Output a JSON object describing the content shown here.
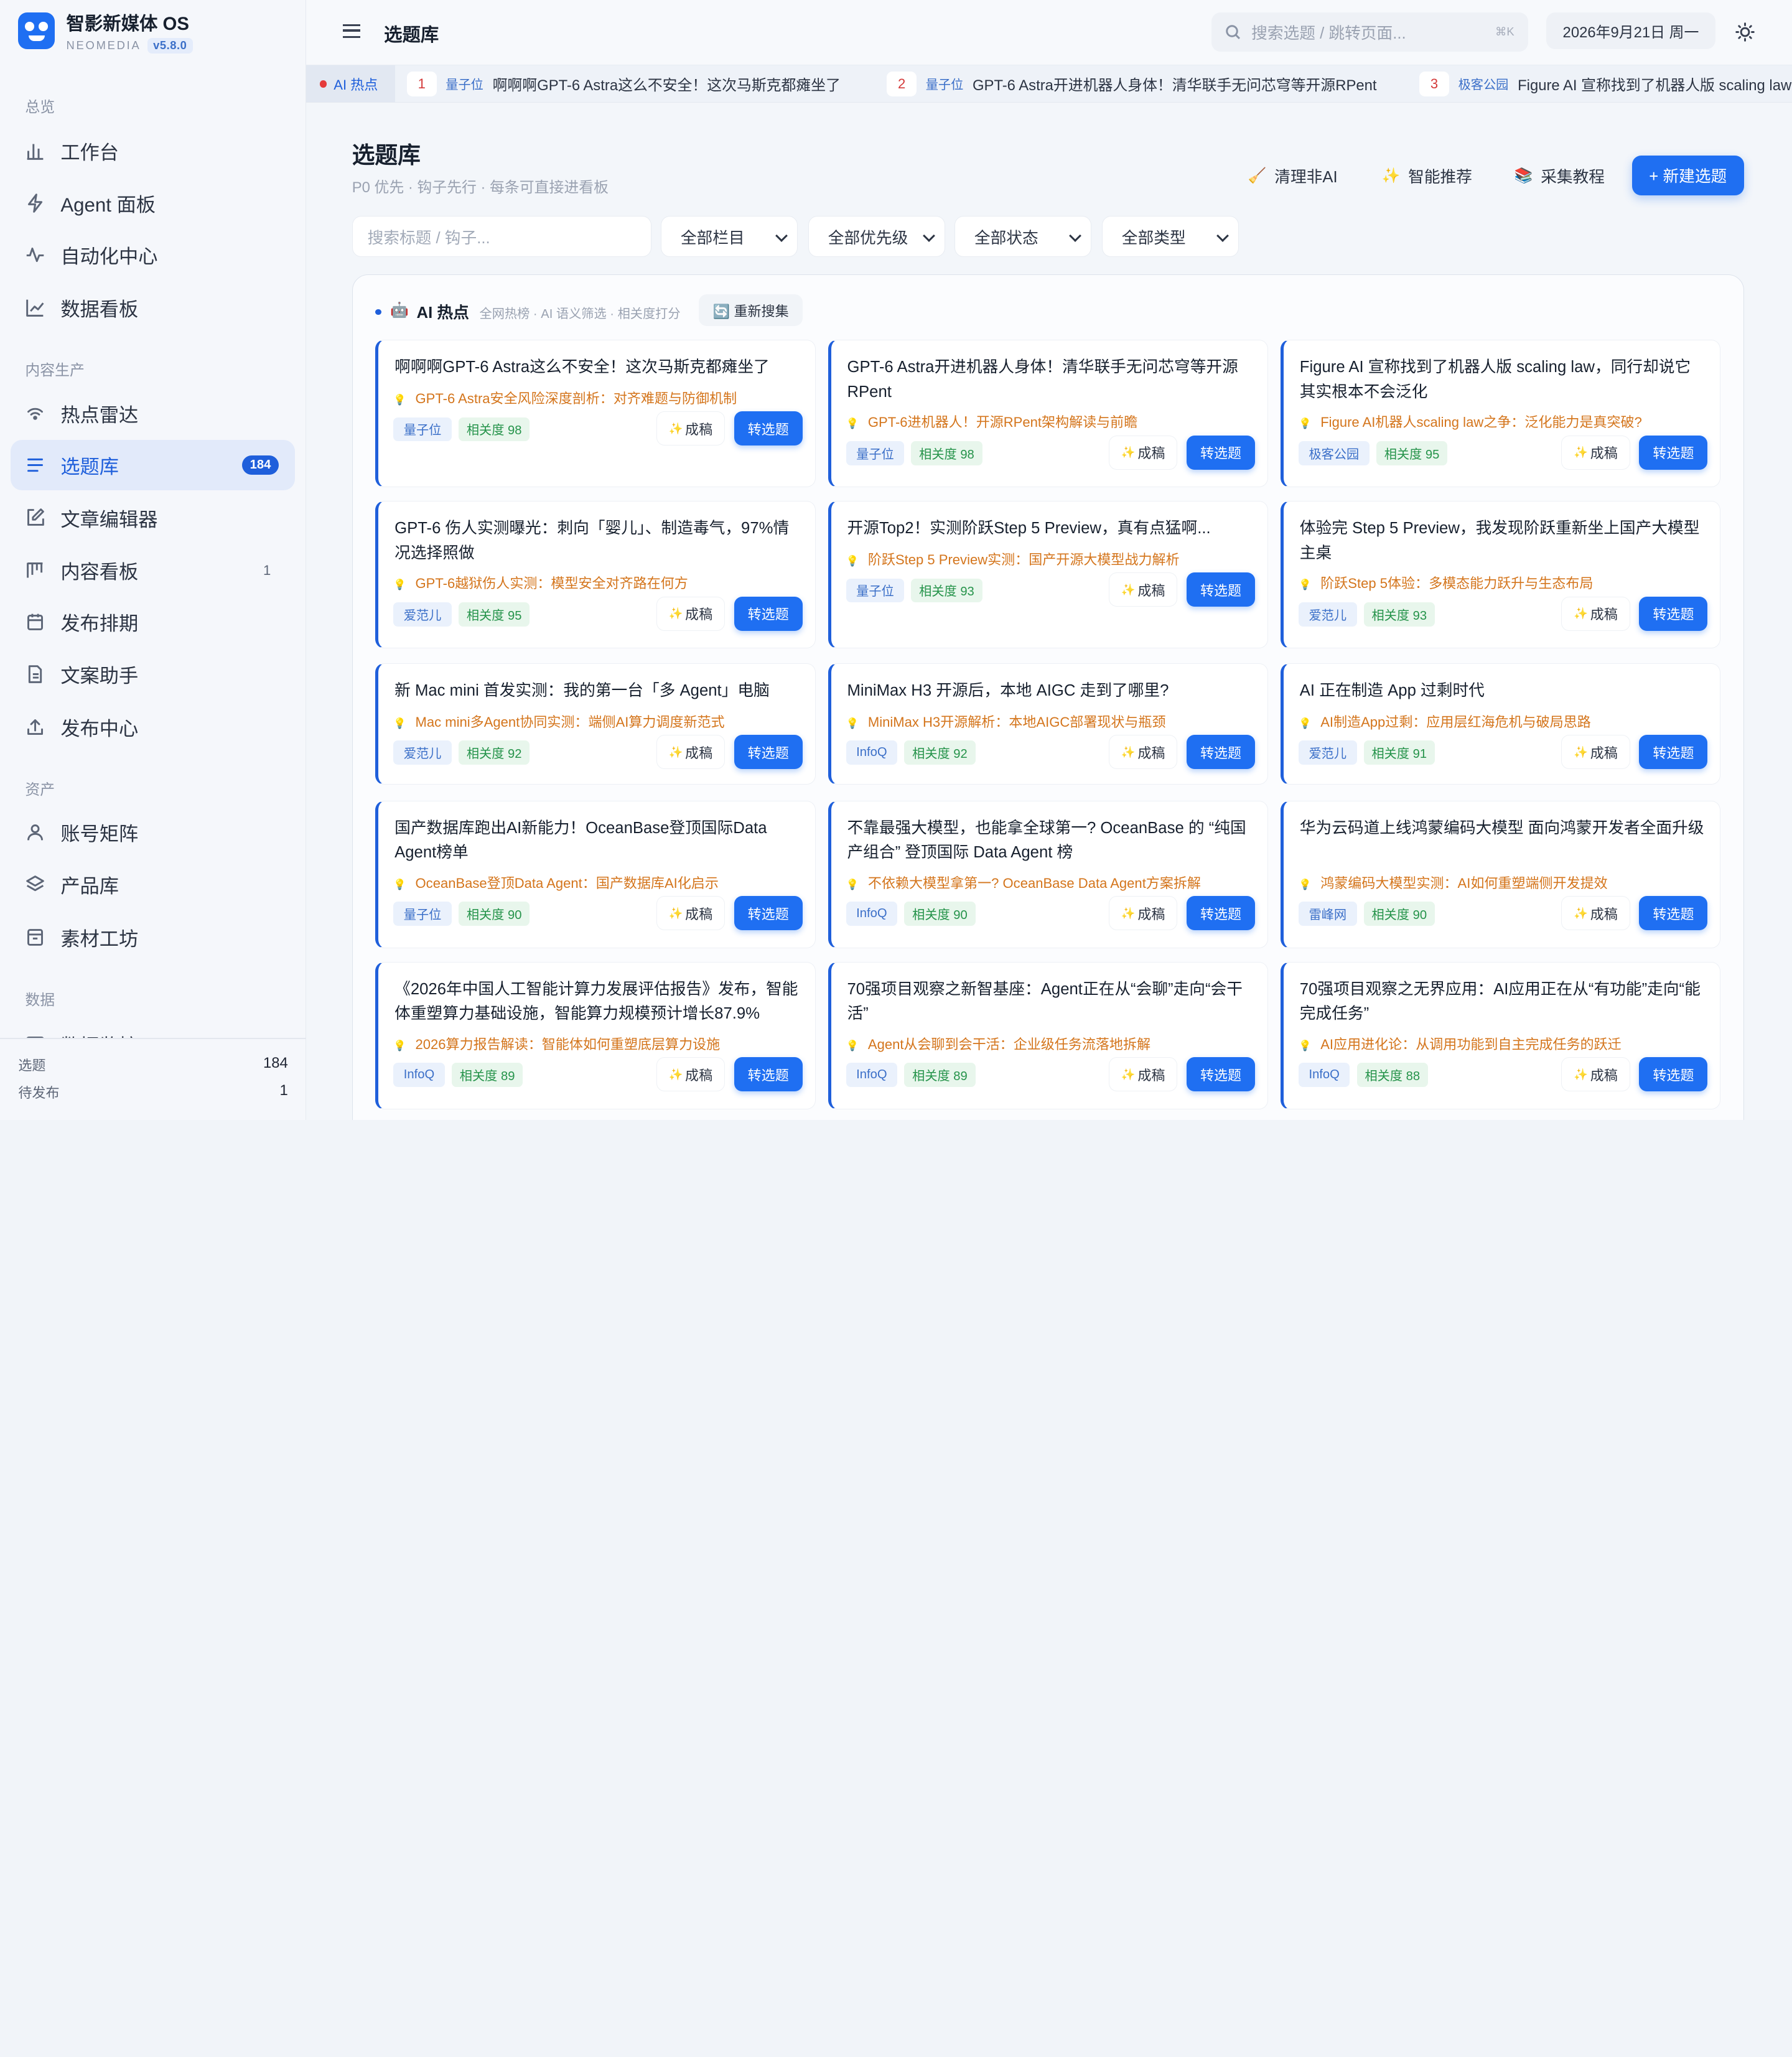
{
  "app": {
    "name": "智影新媒体 OS",
    "sub": "NEOMEDIA",
    "version": "v5.8.0"
  },
  "sidebar": {
    "sections": [
      "总览",
      "内容生产",
      "资产",
      "数据"
    ],
    "items": [
      {
        "label": "工作台",
        "icon": "chart-bar-icon"
      },
      {
        "label": "Agent 面板",
        "icon": "lightning-icon"
      },
      {
        "label": "自动化中心",
        "icon": "activity-icon"
      },
      {
        "label": "数据看板",
        "icon": "line-chart-icon"
      },
      {
        "label": "热点雷达",
        "icon": "signal-icon"
      },
      {
        "label": "选题库",
        "icon": "list-icon",
        "badge": "184"
      },
      {
        "label": "文章编辑器",
        "icon": "edit-icon"
      },
      {
        "label": "内容看板",
        "icon": "kanban-icon",
        "count": "1"
      },
      {
        "label": "发布排期",
        "icon": "calendar-icon"
      },
      {
        "label": "文案助手",
        "icon": "document-icon"
      },
      {
        "label": "发布中心",
        "icon": "upload-icon"
      },
      {
        "label": "账号矩阵",
        "icon": "user-icon"
      },
      {
        "label": "产品库",
        "icon": "layers-icon"
      },
      {
        "label": "素材工坊",
        "icon": "archive-icon"
      },
      {
        "label": "数据监控",
        "icon": "monitor-icon"
      }
    ],
    "stats": [
      {
        "label": "选题",
        "value": "184"
      },
      {
        "label": "待发布",
        "value": "1"
      }
    ]
  },
  "header": {
    "title": "选题库",
    "search_placeholder": "搜索选题 / 跳转页面...",
    "shortcut": "⌘K",
    "date": "2026年9月21日 周一"
  },
  "ticker": {
    "label": "AI 热点",
    "items": [
      {
        "n": "1",
        "src": "量子位",
        "text": "啊啊啊GPT-6 Astra这么不安全！这次马斯克都瘫坐了"
      },
      {
        "n": "2",
        "src": "量子位",
        "text": "GPT-6 Astra开进机器人身体！清华联手无问芯穹等开源RPent"
      },
      {
        "n": "3",
        "src": "极客公园",
        "text": "Figure AI 宣称找到了机器人版 scaling law，同行却说它其实根本不会泛化"
      }
    ]
  },
  "page": {
    "title": "选题库",
    "subtitle": "P0 优先 · 钩子先行 · 每条可直接进看板",
    "actions": [
      {
        "label": "清理非AI",
        "icon": "🧹"
      },
      {
        "label": "智能推荐",
        "icon": "✨"
      },
      {
        "label": "采集教程",
        "icon": "📚"
      }
    ],
    "new_button": "+ 新建选题",
    "filter_placeholder": "搜索标题 / 钩子...",
    "filters": [
      "全部栏目",
      "全部优先级",
      "全部状态",
      "全部类型"
    ]
  },
  "panel": {
    "icon": "🤖",
    "title": "AI 热点",
    "subtitle": "全网热榜 · AI 语义筛选 · 相关度打分",
    "refresh": "🔄 重新搜集",
    "polish_label": "成稿",
    "convert_label": "转选题",
    "cards": [
      {
        "title": "啊啊啊GPT-6 Astra这么不安全！这次马斯克都瘫坐了",
        "hook": "GPT-6 Astra安全风险深度剖析：对齐难题与防御机制",
        "source": "量子位",
        "rel": "相关度 98"
      },
      {
        "title": "GPT-6 Astra开进机器人身体！清华联手无问芯穹等开源RPent",
        "hook": "GPT-6进机器人！开源RPent架构解读与前瞻",
        "source": "量子位",
        "rel": "相关度 98"
      },
      {
        "title": "Figure AI 宣称找到了机器人版 scaling law，同行却说它其实根本不会泛化",
        "hook": "Figure AI机器人scaling law之争：泛化能力是真突破?",
        "source": "极客公园",
        "rel": "相关度 95"
      },
      {
        "title": "GPT-6 伤人实测曝光：刺向「婴儿」、制造毒气，97%情况选择照做",
        "hook": "GPT-6越狱伤人实测：模型安全对齐路在何方",
        "source": "爱范儿",
        "rel": "相关度 95"
      },
      {
        "title": "开源Top2！实测阶跃Step 5 Preview，真有点猛啊...",
        "hook": "阶跃Step 5 Preview实测：国产开源大模型战力解析",
        "source": "量子位",
        "rel": "相关度 93"
      },
      {
        "title": "体验完 Step 5 Preview，我发现阶跃重新坐上国产大模型主桌",
        "hook": "阶跃Step 5体验：多模态能力跃升与生态布局",
        "source": "爱范儿",
        "rel": "相关度 93"
      },
      {
        "title": "新 Mac mini 首发实测：我的第一台「多 Agent」电脑",
        "hook": "Mac mini多Agent协同实测：端侧AI算力调度新范式",
        "source": "爱范儿",
        "rel": "相关度 92"
      },
      {
        "title": "MiniMax H3 开源后，本地 AIGC 走到了哪里?",
        "hook": "MiniMax H3开源解析：本地AIGC部署现状与瓶颈",
        "source": "InfoQ",
        "rel": "相关度 92"
      },
      {
        "title": "AI 正在制造 App 过剩时代",
        "hook": "AI制造App过剩：应用层红海危机与破局思路",
        "source": "爱范儿",
        "rel": "相关度 91"
      },
      {
        "title": "国产数据库跑出AI新能力！OceanBase登顶国际Data Agent榜单",
        "hook": "OceanBase登顶Data Agent：国产数据库AI化启示",
        "source": "量子位",
        "rel": "相关度 90"
      },
      {
        "title": "不靠最强大模型，也能拿全球第一? OceanBase 的 “纯国产组合” 登顶国际 Data Agent 榜",
        "hook": "不依赖大模型拿第一? OceanBase Data Agent方案拆解",
        "source": "InfoQ",
        "rel": "相关度 90"
      },
      {
        "title": "华为云码道上线鸿蒙编码大模型 面向鸿蒙开发者全面升级",
        "hook": "鸿蒙编码大模型实测：AI如何重塑端侧开发提效",
        "source": "雷峰网",
        "rel": "相关度 90"
      },
      {
        "title": "《2026年中国人工智能计算力发展评估报告》发布，智能体重塑算力基础设施，智能算力规模预计增长87.9%",
        "hook": "2026算力报告解读：智能体如何重塑底层算力设施",
        "source": "InfoQ",
        "rel": "相关度 89"
      },
      {
        "title": "70强项目观察之新智基座：Agent正在从“会聊”走向“会干活”",
        "hook": "Agent从会聊到会干活：企业级任务流落地拆解",
        "source": "InfoQ",
        "rel": "相关度 89"
      },
      {
        "title": "70强项目观察之无界应用：AI应用正在从“有功能”走向“能完成任务”",
        "hook": "AI应用进化论：从调用功能到自主完成任务的跃迁",
        "source": "InfoQ",
        "rel": "相关度 88"
      }
    ]
  },
  "fab_icon": "⚡"
}
